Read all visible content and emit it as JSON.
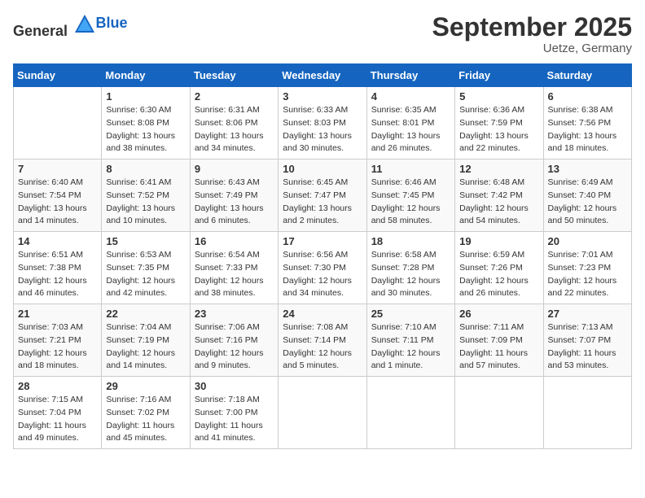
{
  "header": {
    "logo_general": "General",
    "logo_blue": "Blue",
    "month": "September 2025",
    "location": "Uetze, Germany"
  },
  "weekdays": [
    "Sunday",
    "Monday",
    "Tuesday",
    "Wednesday",
    "Thursday",
    "Friday",
    "Saturday"
  ],
  "weeks": [
    [
      {
        "day": "",
        "info": ""
      },
      {
        "day": "1",
        "info": "Sunrise: 6:30 AM\nSunset: 8:08 PM\nDaylight: 13 hours\nand 38 minutes."
      },
      {
        "day": "2",
        "info": "Sunrise: 6:31 AM\nSunset: 8:06 PM\nDaylight: 13 hours\nand 34 minutes."
      },
      {
        "day": "3",
        "info": "Sunrise: 6:33 AM\nSunset: 8:03 PM\nDaylight: 13 hours\nand 30 minutes."
      },
      {
        "day": "4",
        "info": "Sunrise: 6:35 AM\nSunset: 8:01 PM\nDaylight: 13 hours\nand 26 minutes."
      },
      {
        "day": "5",
        "info": "Sunrise: 6:36 AM\nSunset: 7:59 PM\nDaylight: 13 hours\nand 22 minutes."
      },
      {
        "day": "6",
        "info": "Sunrise: 6:38 AM\nSunset: 7:56 PM\nDaylight: 13 hours\nand 18 minutes."
      }
    ],
    [
      {
        "day": "7",
        "info": "Sunrise: 6:40 AM\nSunset: 7:54 PM\nDaylight: 13 hours\nand 14 minutes."
      },
      {
        "day": "8",
        "info": "Sunrise: 6:41 AM\nSunset: 7:52 PM\nDaylight: 13 hours\nand 10 minutes."
      },
      {
        "day": "9",
        "info": "Sunrise: 6:43 AM\nSunset: 7:49 PM\nDaylight: 13 hours\nand 6 minutes."
      },
      {
        "day": "10",
        "info": "Sunrise: 6:45 AM\nSunset: 7:47 PM\nDaylight: 13 hours\nand 2 minutes."
      },
      {
        "day": "11",
        "info": "Sunrise: 6:46 AM\nSunset: 7:45 PM\nDaylight: 12 hours\nand 58 minutes."
      },
      {
        "day": "12",
        "info": "Sunrise: 6:48 AM\nSunset: 7:42 PM\nDaylight: 12 hours\nand 54 minutes."
      },
      {
        "day": "13",
        "info": "Sunrise: 6:49 AM\nSunset: 7:40 PM\nDaylight: 12 hours\nand 50 minutes."
      }
    ],
    [
      {
        "day": "14",
        "info": "Sunrise: 6:51 AM\nSunset: 7:38 PM\nDaylight: 12 hours\nand 46 minutes."
      },
      {
        "day": "15",
        "info": "Sunrise: 6:53 AM\nSunset: 7:35 PM\nDaylight: 12 hours\nand 42 minutes."
      },
      {
        "day": "16",
        "info": "Sunrise: 6:54 AM\nSunset: 7:33 PM\nDaylight: 12 hours\nand 38 minutes."
      },
      {
        "day": "17",
        "info": "Sunrise: 6:56 AM\nSunset: 7:30 PM\nDaylight: 12 hours\nand 34 minutes."
      },
      {
        "day": "18",
        "info": "Sunrise: 6:58 AM\nSunset: 7:28 PM\nDaylight: 12 hours\nand 30 minutes."
      },
      {
        "day": "19",
        "info": "Sunrise: 6:59 AM\nSunset: 7:26 PM\nDaylight: 12 hours\nand 26 minutes."
      },
      {
        "day": "20",
        "info": "Sunrise: 7:01 AM\nSunset: 7:23 PM\nDaylight: 12 hours\nand 22 minutes."
      }
    ],
    [
      {
        "day": "21",
        "info": "Sunrise: 7:03 AM\nSunset: 7:21 PM\nDaylight: 12 hours\nand 18 minutes."
      },
      {
        "day": "22",
        "info": "Sunrise: 7:04 AM\nSunset: 7:19 PM\nDaylight: 12 hours\nand 14 minutes."
      },
      {
        "day": "23",
        "info": "Sunrise: 7:06 AM\nSunset: 7:16 PM\nDaylight: 12 hours\nand 9 minutes."
      },
      {
        "day": "24",
        "info": "Sunrise: 7:08 AM\nSunset: 7:14 PM\nDaylight: 12 hours\nand 5 minutes."
      },
      {
        "day": "25",
        "info": "Sunrise: 7:10 AM\nSunset: 7:11 PM\nDaylight: 12 hours\nand 1 minute."
      },
      {
        "day": "26",
        "info": "Sunrise: 7:11 AM\nSunset: 7:09 PM\nDaylight: 11 hours\nand 57 minutes."
      },
      {
        "day": "27",
        "info": "Sunrise: 7:13 AM\nSunset: 7:07 PM\nDaylight: 11 hours\nand 53 minutes."
      }
    ],
    [
      {
        "day": "28",
        "info": "Sunrise: 7:15 AM\nSunset: 7:04 PM\nDaylight: 11 hours\nand 49 minutes."
      },
      {
        "day": "29",
        "info": "Sunrise: 7:16 AM\nSunset: 7:02 PM\nDaylight: 11 hours\nand 45 minutes."
      },
      {
        "day": "30",
        "info": "Sunrise: 7:18 AM\nSunset: 7:00 PM\nDaylight: 11 hours\nand 41 minutes."
      },
      {
        "day": "",
        "info": ""
      },
      {
        "day": "",
        "info": ""
      },
      {
        "day": "",
        "info": ""
      },
      {
        "day": "",
        "info": ""
      }
    ]
  ]
}
